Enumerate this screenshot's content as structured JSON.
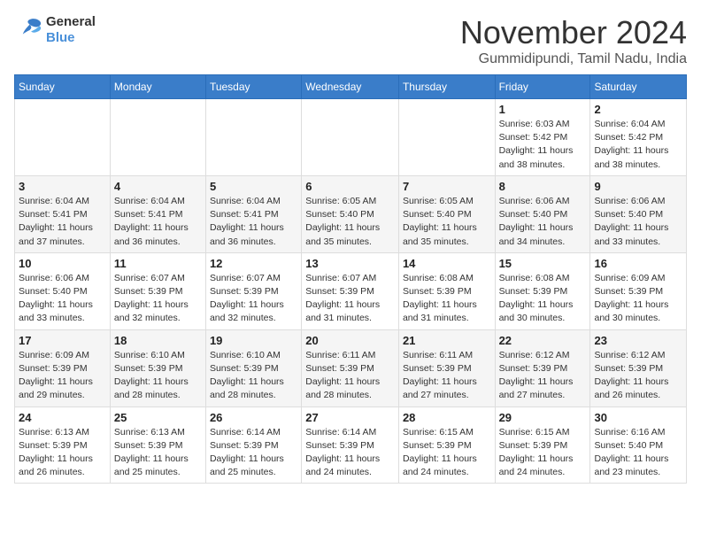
{
  "logo": {
    "general": "General",
    "blue": "Blue"
  },
  "title": "November 2024",
  "location": "Gummidipundi, Tamil Nadu, India",
  "days_of_week": [
    "Sunday",
    "Monday",
    "Tuesday",
    "Wednesday",
    "Thursday",
    "Friday",
    "Saturday"
  ],
  "weeks": [
    [
      {
        "day": "",
        "info": ""
      },
      {
        "day": "",
        "info": ""
      },
      {
        "day": "",
        "info": ""
      },
      {
        "day": "",
        "info": ""
      },
      {
        "day": "",
        "info": ""
      },
      {
        "day": "1",
        "info": "Sunrise: 6:03 AM\nSunset: 5:42 PM\nDaylight: 11 hours and 38 minutes."
      },
      {
        "day": "2",
        "info": "Sunrise: 6:04 AM\nSunset: 5:42 PM\nDaylight: 11 hours and 38 minutes."
      }
    ],
    [
      {
        "day": "3",
        "info": "Sunrise: 6:04 AM\nSunset: 5:41 PM\nDaylight: 11 hours and 37 minutes."
      },
      {
        "day": "4",
        "info": "Sunrise: 6:04 AM\nSunset: 5:41 PM\nDaylight: 11 hours and 36 minutes."
      },
      {
        "day": "5",
        "info": "Sunrise: 6:04 AM\nSunset: 5:41 PM\nDaylight: 11 hours and 36 minutes."
      },
      {
        "day": "6",
        "info": "Sunrise: 6:05 AM\nSunset: 5:40 PM\nDaylight: 11 hours and 35 minutes."
      },
      {
        "day": "7",
        "info": "Sunrise: 6:05 AM\nSunset: 5:40 PM\nDaylight: 11 hours and 35 minutes."
      },
      {
        "day": "8",
        "info": "Sunrise: 6:06 AM\nSunset: 5:40 PM\nDaylight: 11 hours and 34 minutes."
      },
      {
        "day": "9",
        "info": "Sunrise: 6:06 AM\nSunset: 5:40 PM\nDaylight: 11 hours and 33 minutes."
      }
    ],
    [
      {
        "day": "10",
        "info": "Sunrise: 6:06 AM\nSunset: 5:40 PM\nDaylight: 11 hours and 33 minutes."
      },
      {
        "day": "11",
        "info": "Sunrise: 6:07 AM\nSunset: 5:39 PM\nDaylight: 11 hours and 32 minutes."
      },
      {
        "day": "12",
        "info": "Sunrise: 6:07 AM\nSunset: 5:39 PM\nDaylight: 11 hours and 32 minutes."
      },
      {
        "day": "13",
        "info": "Sunrise: 6:07 AM\nSunset: 5:39 PM\nDaylight: 11 hours and 31 minutes."
      },
      {
        "day": "14",
        "info": "Sunrise: 6:08 AM\nSunset: 5:39 PM\nDaylight: 11 hours and 31 minutes."
      },
      {
        "day": "15",
        "info": "Sunrise: 6:08 AM\nSunset: 5:39 PM\nDaylight: 11 hours and 30 minutes."
      },
      {
        "day": "16",
        "info": "Sunrise: 6:09 AM\nSunset: 5:39 PM\nDaylight: 11 hours and 30 minutes."
      }
    ],
    [
      {
        "day": "17",
        "info": "Sunrise: 6:09 AM\nSunset: 5:39 PM\nDaylight: 11 hours and 29 minutes."
      },
      {
        "day": "18",
        "info": "Sunrise: 6:10 AM\nSunset: 5:39 PM\nDaylight: 11 hours and 28 minutes."
      },
      {
        "day": "19",
        "info": "Sunrise: 6:10 AM\nSunset: 5:39 PM\nDaylight: 11 hours and 28 minutes."
      },
      {
        "day": "20",
        "info": "Sunrise: 6:11 AM\nSunset: 5:39 PM\nDaylight: 11 hours and 28 minutes."
      },
      {
        "day": "21",
        "info": "Sunrise: 6:11 AM\nSunset: 5:39 PM\nDaylight: 11 hours and 27 minutes."
      },
      {
        "day": "22",
        "info": "Sunrise: 6:12 AM\nSunset: 5:39 PM\nDaylight: 11 hours and 27 minutes."
      },
      {
        "day": "23",
        "info": "Sunrise: 6:12 AM\nSunset: 5:39 PM\nDaylight: 11 hours and 26 minutes."
      }
    ],
    [
      {
        "day": "24",
        "info": "Sunrise: 6:13 AM\nSunset: 5:39 PM\nDaylight: 11 hours and 26 minutes."
      },
      {
        "day": "25",
        "info": "Sunrise: 6:13 AM\nSunset: 5:39 PM\nDaylight: 11 hours and 25 minutes."
      },
      {
        "day": "26",
        "info": "Sunrise: 6:14 AM\nSunset: 5:39 PM\nDaylight: 11 hours and 25 minutes."
      },
      {
        "day": "27",
        "info": "Sunrise: 6:14 AM\nSunset: 5:39 PM\nDaylight: 11 hours and 24 minutes."
      },
      {
        "day": "28",
        "info": "Sunrise: 6:15 AM\nSunset: 5:39 PM\nDaylight: 11 hours and 24 minutes."
      },
      {
        "day": "29",
        "info": "Sunrise: 6:15 AM\nSunset: 5:39 PM\nDaylight: 11 hours and 24 minutes."
      },
      {
        "day": "30",
        "info": "Sunrise: 6:16 AM\nSunset: 5:40 PM\nDaylight: 11 hours and 23 minutes."
      }
    ]
  ]
}
